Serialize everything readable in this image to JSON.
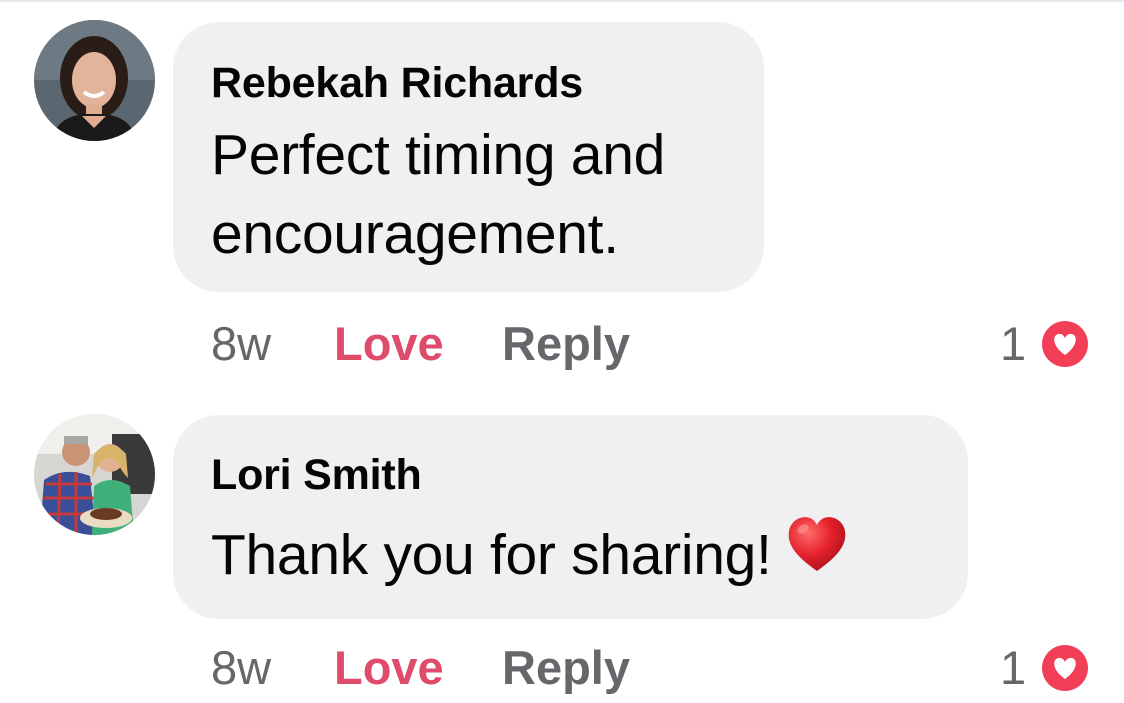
{
  "comments": [
    {
      "author": "Rebekah Richards",
      "text_lines": [
        "Perfect timing and",
        "encouragement."
      ],
      "time": "8w",
      "love_label": "Love",
      "reply_label": "Reply",
      "reaction_count": "1",
      "reaction_icon": "love-reaction-icon",
      "avatar": "profile-photo-woman"
    },
    {
      "author": "Lori Smith",
      "text": "Thank you for sharing!",
      "emoji": "red-heart-emoji",
      "time": "8w",
      "love_label": "Love",
      "reply_label": "Reply",
      "reaction_count": "1",
      "reaction_icon": "love-reaction-icon",
      "avatar": "profile-photo-couple"
    }
  ],
  "colors": {
    "bubble": "#f0f0f3",
    "love": "#de4b6b",
    "secondary_text": "#65676b",
    "reaction_badge": "#f33e58"
  }
}
